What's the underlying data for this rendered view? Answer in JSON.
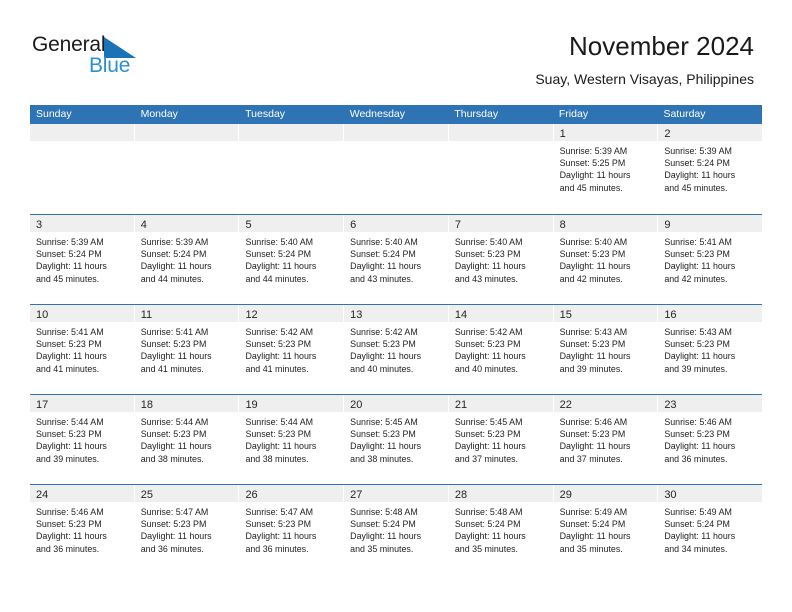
{
  "brand": {
    "name_top": "General",
    "name_bottom": "Blue",
    "accent_color": "#2c8fd6",
    "triangle_color": "#1a73b7"
  },
  "header": {
    "title": "November 2024",
    "subtitle": "Suay, Western Visayas, Philippines"
  },
  "calendar": {
    "header_color": "#2e74b5",
    "daynum_band_color": "#efefef",
    "day_names": [
      "Sunday",
      "Monday",
      "Tuesday",
      "Wednesday",
      "Thursday",
      "Friday",
      "Saturday"
    ],
    "labels": {
      "sunrise": "Sunrise:",
      "sunset": "Sunset:",
      "daylight": "Daylight:"
    },
    "weeks": [
      [
        {
          "day": null
        },
        {
          "day": null
        },
        {
          "day": null
        },
        {
          "day": null
        },
        {
          "day": null
        },
        {
          "day": "1",
          "sunrise": "Sunrise: 5:39 AM",
          "sunset": "Sunset: 5:25 PM",
          "daylight_1": "Daylight: 11 hours",
          "daylight_2": "and 45 minutes."
        },
        {
          "day": "2",
          "sunrise": "Sunrise: 5:39 AM",
          "sunset": "Sunset: 5:24 PM",
          "daylight_1": "Daylight: 11 hours",
          "daylight_2": "and 45 minutes."
        }
      ],
      [
        {
          "day": "3",
          "sunrise": "Sunrise: 5:39 AM",
          "sunset": "Sunset: 5:24 PM",
          "daylight_1": "Daylight: 11 hours",
          "daylight_2": "and 45 minutes."
        },
        {
          "day": "4",
          "sunrise": "Sunrise: 5:39 AM",
          "sunset": "Sunset: 5:24 PM",
          "daylight_1": "Daylight: 11 hours",
          "daylight_2": "and 44 minutes."
        },
        {
          "day": "5",
          "sunrise": "Sunrise: 5:40 AM",
          "sunset": "Sunset: 5:24 PM",
          "daylight_1": "Daylight: 11 hours",
          "daylight_2": "and 44 minutes."
        },
        {
          "day": "6",
          "sunrise": "Sunrise: 5:40 AM",
          "sunset": "Sunset: 5:24 PM",
          "daylight_1": "Daylight: 11 hours",
          "daylight_2": "and 43 minutes."
        },
        {
          "day": "7",
          "sunrise": "Sunrise: 5:40 AM",
          "sunset": "Sunset: 5:23 PM",
          "daylight_1": "Daylight: 11 hours",
          "daylight_2": "and 43 minutes."
        },
        {
          "day": "8",
          "sunrise": "Sunrise: 5:40 AM",
          "sunset": "Sunset: 5:23 PM",
          "daylight_1": "Daylight: 11 hours",
          "daylight_2": "and 42 minutes."
        },
        {
          "day": "9",
          "sunrise": "Sunrise: 5:41 AM",
          "sunset": "Sunset: 5:23 PM",
          "daylight_1": "Daylight: 11 hours",
          "daylight_2": "and 42 minutes."
        }
      ],
      [
        {
          "day": "10",
          "sunrise": "Sunrise: 5:41 AM",
          "sunset": "Sunset: 5:23 PM",
          "daylight_1": "Daylight: 11 hours",
          "daylight_2": "and 41 minutes."
        },
        {
          "day": "11",
          "sunrise": "Sunrise: 5:41 AM",
          "sunset": "Sunset: 5:23 PM",
          "daylight_1": "Daylight: 11 hours",
          "daylight_2": "and 41 minutes."
        },
        {
          "day": "12",
          "sunrise": "Sunrise: 5:42 AM",
          "sunset": "Sunset: 5:23 PM",
          "daylight_1": "Daylight: 11 hours",
          "daylight_2": "and 41 minutes."
        },
        {
          "day": "13",
          "sunrise": "Sunrise: 5:42 AM",
          "sunset": "Sunset: 5:23 PM",
          "daylight_1": "Daylight: 11 hours",
          "daylight_2": "and 40 minutes."
        },
        {
          "day": "14",
          "sunrise": "Sunrise: 5:42 AM",
          "sunset": "Sunset: 5:23 PM",
          "daylight_1": "Daylight: 11 hours",
          "daylight_2": "and 40 minutes."
        },
        {
          "day": "15",
          "sunrise": "Sunrise: 5:43 AM",
          "sunset": "Sunset: 5:23 PM",
          "daylight_1": "Daylight: 11 hours",
          "daylight_2": "and 39 minutes."
        },
        {
          "day": "16",
          "sunrise": "Sunrise: 5:43 AM",
          "sunset": "Sunset: 5:23 PM",
          "daylight_1": "Daylight: 11 hours",
          "daylight_2": "and 39 minutes."
        }
      ],
      [
        {
          "day": "17",
          "sunrise": "Sunrise: 5:44 AM",
          "sunset": "Sunset: 5:23 PM",
          "daylight_1": "Daylight: 11 hours",
          "daylight_2": "and 39 minutes."
        },
        {
          "day": "18",
          "sunrise": "Sunrise: 5:44 AM",
          "sunset": "Sunset: 5:23 PM",
          "daylight_1": "Daylight: 11 hours",
          "daylight_2": "and 38 minutes."
        },
        {
          "day": "19",
          "sunrise": "Sunrise: 5:44 AM",
          "sunset": "Sunset: 5:23 PM",
          "daylight_1": "Daylight: 11 hours",
          "daylight_2": "and 38 minutes."
        },
        {
          "day": "20",
          "sunrise": "Sunrise: 5:45 AM",
          "sunset": "Sunset: 5:23 PM",
          "daylight_1": "Daylight: 11 hours",
          "daylight_2": "and 38 minutes."
        },
        {
          "day": "21",
          "sunrise": "Sunrise: 5:45 AM",
          "sunset": "Sunset: 5:23 PM",
          "daylight_1": "Daylight: 11 hours",
          "daylight_2": "and 37 minutes."
        },
        {
          "day": "22",
          "sunrise": "Sunrise: 5:46 AM",
          "sunset": "Sunset: 5:23 PM",
          "daylight_1": "Daylight: 11 hours",
          "daylight_2": "and 37 minutes."
        },
        {
          "day": "23",
          "sunrise": "Sunrise: 5:46 AM",
          "sunset": "Sunset: 5:23 PM",
          "daylight_1": "Daylight: 11 hours",
          "daylight_2": "and 36 minutes."
        }
      ],
      [
        {
          "day": "24",
          "sunrise": "Sunrise: 5:46 AM",
          "sunset": "Sunset: 5:23 PM",
          "daylight_1": "Daylight: 11 hours",
          "daylight_2": "and 36 minutes."
        },
        {
          "day": "25",
          "sunrise": "Sunrise: 5:47 AM",
          "sunset": "Sunset: 5:23 PM",
          "daylight_1": "Daylight: 11 hours",
          "daylight_2": "and 36 minutes."
        },
        {
          "day": "26",
          "sunrise": "Sunrise: 5:47 AM",
          "sunset": "Sunset: 5:23 PM",
          "daylight_1": "Daylight: 11 hours",
          "daylight_2": "and 36 minutes."
        },
        {
          "day": "27",
          "sunrise": "Sunrise: 5:48 AM",
          "sunset": "Sunset: 5:24 PM",
          "daylight_1": "Daylight: 11 hours",
          "daylight_2": "and 35 minutes."
        },
        {
          "day": "28",
          "sunrise": "Sunrise: 5:48 AM",
          "sunset": "Sunset: 5:24 PM",
          "daylight_1": "Daylight: 11 hours",
          "daylight_2": "and 35 minutes."
        },
        {
          "day": "29",
          "sunrise": "Sunrise: 5:49 AM",
          "sunset": "Sunset: 5:24 PM",
          "daylight_1": "Daylight: 11 hours",
          "daylight_2": "and 35 minutes."
        },
        {
          "day": "30",
          "sunrise": "Sunrise: 5:49 AM",
          "sunset": "Sunset: 5:24 PM",
          "daylight_1": "Daylight: 11 hours",
          "daylight_2": "and 34 minutes."
        }
      ]
    ]
  }
}
